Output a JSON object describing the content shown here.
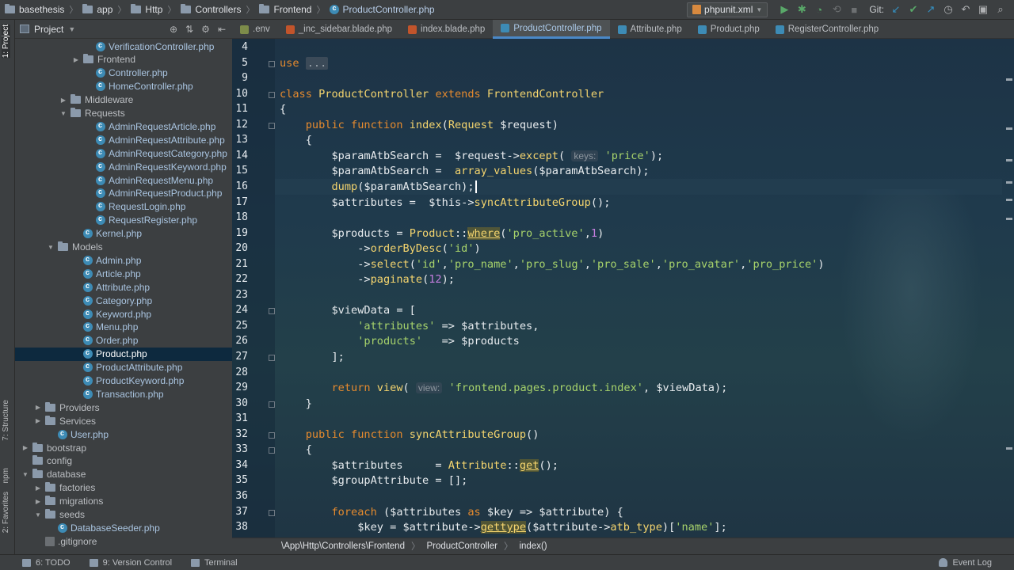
{
  "navbar": {
    "crumbs": [
      "basethesis",
      "app",
      "Http",
      "Controllers",
      "Frontend",
      "ProductController.php"
    ],
    "run_config": "phpunit.xml",
    "git_label": "Git:"
  },
  "left_strip": {
    "project_tab": "1: Project",
    "structure_tab": "7: Structure",
    "npm_tab": "npm",
    "favorites_tab": "2: Favorites"
  },
  "project_panel": {
    "title": "Project",
    "rows": [
      {
        "label": "VerificationController.php",
        "type": "class",
        "indent": 5,
        "toggle": ""
      },
      {
        "label": "Frontend",
        "type": "dir",
        "indent": 4,
        "toggle": "closed"
      },
      {
        "label": "Controller.php",
        "type": "class",
        "indent": 5,
        "toggle": ""
      },
      {
        "label": "HomeController.php",
        "type": "class",
        "indent": 5,
        "toggle": ""
      },
      {
        "label": "Middleware",
        "type": "dir",
        "indent": 3,
        "toggle": "closed"
      },
      {
        "label": "Requests",
        "type": "dir",
        "indent": 3,
        "toggle": "open"
      },
      {
        "label": "AdminRequestArticle.php",
        "type": "class",
        "indent": 5,
        "toggle": ""
      },
      {
        "label": "AdminRequestAttribute.php",
        "type": "class",
        "indent": 5,
        "toggle": ""
      },
      {
        "label": "AdminRequestCategory.php",
        "type": "class",
        "indent": 5,
        "toggle": ""
      },
      {
        "label": "AdminRequestKeyword.php",
        "type": "class",
        "indent": 5,
        "toggle": ""
      },
      {
        "label": "AdminRequestMenu.php",
        "type": "class",
        "indent": 5,
        "toggle": ""
      },
      {
        "label": "AdminRequestProduct.php",
        "type": "class",
        "indent": 5,
        "toggle": ""
      },
      {
        "label": "RequestLogin.php",
        "type": "class",
        "indent": 5,
        "toggle": ""
      },
      {
        "label": "RequestRegister.php",
        "type": "class",
        "indent": 5,
        "toggle": ""
      },
      {
        "label": "Kernel.php",
        "type": "class",
        "indent": 4,
        "toggle": ""
      },
      {
        "label": "Models",
        "type": "dir",
        "indent": 2,
        "toggle": "open"
      },
      {
        "label": "Admin.php",
        "type": "class",
        "indent": 4,
        "toggle": ""
      },
      {
        "label": "Article.php",
        "type": "class",
        "indent": 4,
        "toggle": ""
      },
      {
        "label": "Attribute.php",
        "type": "class",
        "indent": 4,
        "toggle": ""
      },
      {
        "label": "Category.php",
        "type": "class",
        "indent": 4,
        "toggle": ""
      },
      {
        "label": "Keyword.php",
        "type": "class",
        "indent": 4,
        "toggle": ""
      },
      {
        "label": "Menu.php",
        "type": "class",
        "indent": 4,
        "toggle": ""
      },
      {
        "label": "Order.php",
        "type": "class",
        "indent": 4,
        "toggle": ""
      },
      {
        "label": "Product.php",
        "type": "class",
        "indent": 4,
        "toggle": "",
        "selected": true
      },
      {
        "label": "ProductAttribute.php",
        "type": "class",
        "indent": 4,
        "toggle": ""
      },
      {
        "label": "ProductKeyword.php",
        "type": "class",
        "indent": 4,
        "toggle": ""
      },
      {
        "label": "Transaction.php",
        "type": "class",
        "indent": 4,
        "toggle": ""
      },
      {
        "label": "Providers",
        "type": "dir",
        "indent": 1,
        "toggle": "closed"
      },
      {
        "label": "Services",
        "type": "dir",
        "indent": 1,
        "toggle": "closed"
      },
      {
        "label": "User.php",
        "type": "class",
        "indent": 2,
        "toggle": ""
      },
      {
        "label": "bootstrap",
        "type": "dir",
        "indent": 0,
        "toggle": "closed"
      },
      {
        "label": "config",
        "type": "dir",
        "indent": 0,
        "toggle": ""
      },
      {
        "label": "database",
        "type": "dir",
        "indent": 0,
        "toggle": "open"
      },
      {
        "label": "factories",
        "type": "dir",
        "indent": 1,
        "toggle": "closed"
      },
      {
        "label": "migrations",
        "type": "dir",
        "indent": 1,
        "toggle": "closed"
      },
      {
        "label": "seeds",
        "type": "dir",
        "indent": 1,
        "toggle": "open"
      },
      {
        "label": "DatabaseSeeder.php",
        "type": "class",
        "indent": 2,
        "toggle": ""
      },
      {
        "label": ".gitignore",
        "type": "git",
        "indent": 1,
        "toggle": ""
      }
    ]
  },
  "tabs": [
    {
      "label": ".env",
      "color": "#7d8c4a"
    },
    {
      "label": "_inc_sidebar.blade.php",
      "color": "#c2542b"
    },
    {
      "label": "index.blade.php",
      "color": "#c2542b"
    },
    {
      "label": "ProductController.php",
      "color": "#3d8bb5",
      "active": true
    },
    {
      "label": "Attribute.php",
      "color": "#3d8bb5"
    },
    {
      "label": "Product.php",
      "color": "#3d8bb5"
    },
    {
      "label": "RegisterController.php",
      "color": "#3d8bb5"
    }
  ],
  "editor": {
    "current_line": 16,
    "lines": [
      {
        "n": 4,
        "html": ""
      },
      {
        "n": 5,
        "html": "<span class='k'>use</span> <span class='fold'>...</span>"
      },
      {
        "n": 9,
        "html": ""
      },
      {
        "n": 10,
        "html": "<span class='k'>class</span> <span class='c'>ProductController</span> <span class='k'>extends</span> <span class='c'>FrontendController</span>"
      },
      {
        "n": 11,
        "html": "{"
      },
      {
        "n": 12,
        "html": "    <span class='k'>public function</span> <span class='f'>index</span>(<span class='c'>Request</span> $request)"
      },
      {
        "n": 13,
        "html": "    {"
      },
      {
        "n": 14,
        "html": "        $paramAtbSearch =  $request-><span class='f'>except</span>( <span class='hint'>keys:</span> <span class='s'>'price'</span>);"
      },
      {
        "n": 15,
        "html": "        $paramAtbSearch =  <span class='f'>array_values</span>($paramAtbSearch);"
      },
      {
        "n": 16,
        "html": "        <span class='f'>dump</span>($paramAtbSearch);<span class='caret'></span>"
      },
      {
        "n": 17,
        "html": "        $attributes =  $this-><span class='f'>syncAttributeGroup</span>();"
      },
      {
        "n": 18,
        "html": ""
      },
      {
        "n": 19,
        "html": "        $products = <span class='c'>Product</span>::<span class='f ul'>where</span>(<span class='s'>'pro_active'</span>,<span class='n'>1</span>)"
      },
      {
        "n": 20,
        "html": "            -><span class='f'>orderByDesc</span>(<span class='s'>'id'</span>)"
      },
      {
        "n": 21,
        "html": "            -><span class='f'>select</span>(<span class='s'>'id'</span>,<span class='s'>'pro_name'</span>,<span class='s'>'pro_slug'</span>,<span class='s'>'pro_sale'</span>,<span class='s'>'pro_avatar'</span>,<span class='s'>'pro_price'</span>)"
      },
      {
        "n": 22,
        "html": "            -><span class='f'>paginate</span>(<span class='n'>12</span>);"
      },
      {
        "n": 23,
        "html": ""
      },
      {
        "n": 24,
        "html": "        $viewData = ["
      },
      {
        "n": 25,
        "html": "            <span class='s'>'attributes'</span> => $attributes,"
      },
      {
        "n": 26,
        "html": "            <span class='s'>'products'</span>   => $products"
      },
      {
        "n": 27,
        "html": "        ];"
      },
      {
        "n": 28,
        "html": ""
      },
      {
        "n": 29,
        "html": "        <span class='k'>return</span> <span class='f'>view</span>( <span class='hint'>view:</span> <span class='s'>'frontend.pages.product.index'</span>, $viewData);"
      },
      {
        "n": 30,
        "html": "    }"
      },
      {
        "n": 31,
        "html": ""
      },
      {
        "n": 32,
        "html": "    <span class='k'>public function</span> <span class='f'>syncAttributeGroup</span>()"
      },
      {
        "n": 33,
        "html": "    {"
      },
      {
        "n": 34,
        "html": "        $attributes     = <span class='c'>Attribute</span>::<span class='f ul'>get</span>();"
      },
      {
        "n": 35,
        "html": "        $groupAttribute = [];"
      },
      {
        "n": 36,
        "html": ""
      },
      {
        "n": 37,
        "html": "        <span class='k'>foreach</span> ($attributes <span class='k'>as</span> $key => $attribute) {"
      },
      {
        "n": 38,
        "html": "            $key = $attribute-><span class='f ul'>gettype</span>($attribute-><span class='f'>atb_type</span>)[<span class='s'>'name'</span>];"
      }
    ]
  },
  "editor_breadcrumb": [
    "\\App\\Http\\Controllers\\Frontend",
    "ProductController",
    "index()"
  ],
  "status_bar": {
    "todo": "6: TODO",
    "vcs": "9: Version Control",
    "terminal": "Terminal",
    "event_log": "Event Log"
  }
}
